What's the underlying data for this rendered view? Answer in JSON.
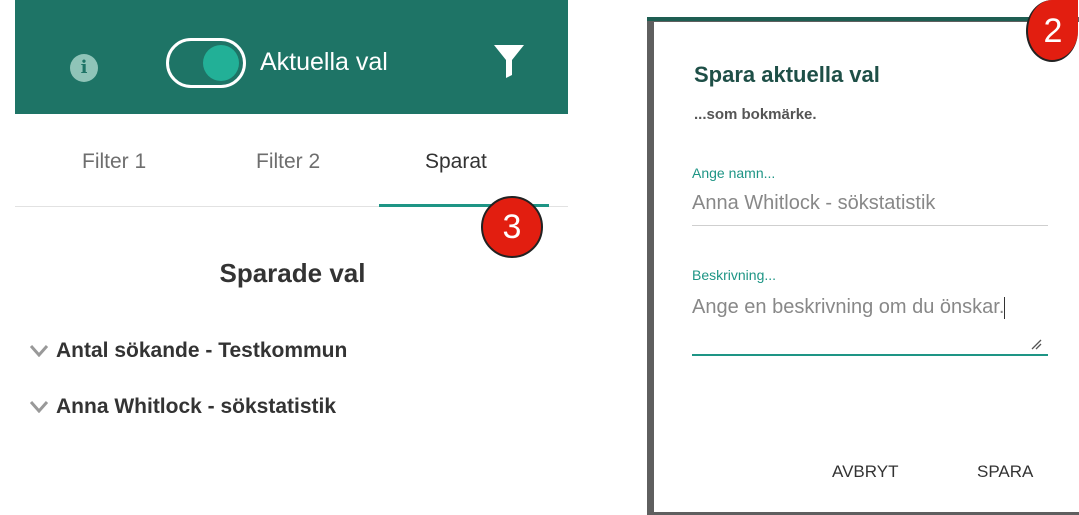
{
  "header": {
    "toggle_label": "Aktuella val",
    "info_icon": "info-icon",
    "filter_icon": "filter-icon",
    "colors": {
      "bar": "#1e7466",
      "toggle_knob": "#22b097",
      "accent": "#1e9585",
      "badge": "#e21e10"
    }
  },
  "tabs": [
    {
      "label": "Filter 1"
    },
    {
      "label": "Filter 2"
    },
    {
      "label": "Sparat",
      "active": true
    }
  ],
  "badges": {
    "left": "3",
    "right": "2"
  },
  "saved": {
    "title": "Sparade val",
    "items": [
      {
        "label": "Antal sökande - Testkommun"
      },
      {
        "label": "Anna Whitlock - sökstatistik"
      }
    ]
  },
  "dialog": {
    "title": "Spara aktuella val",
    "subtitle": "...som bokmärke.",
    "name_label": "Ange namn...",
    "name_value": "Anna Whitlock - sökstatistik",
    "desc_label": "Beskrivning...",
    "desc_value": "Ange en beskrivning om du önskar.",
    "cancel_label": "AVBRYT",
    "save_label": "SPARA"
  }
}
